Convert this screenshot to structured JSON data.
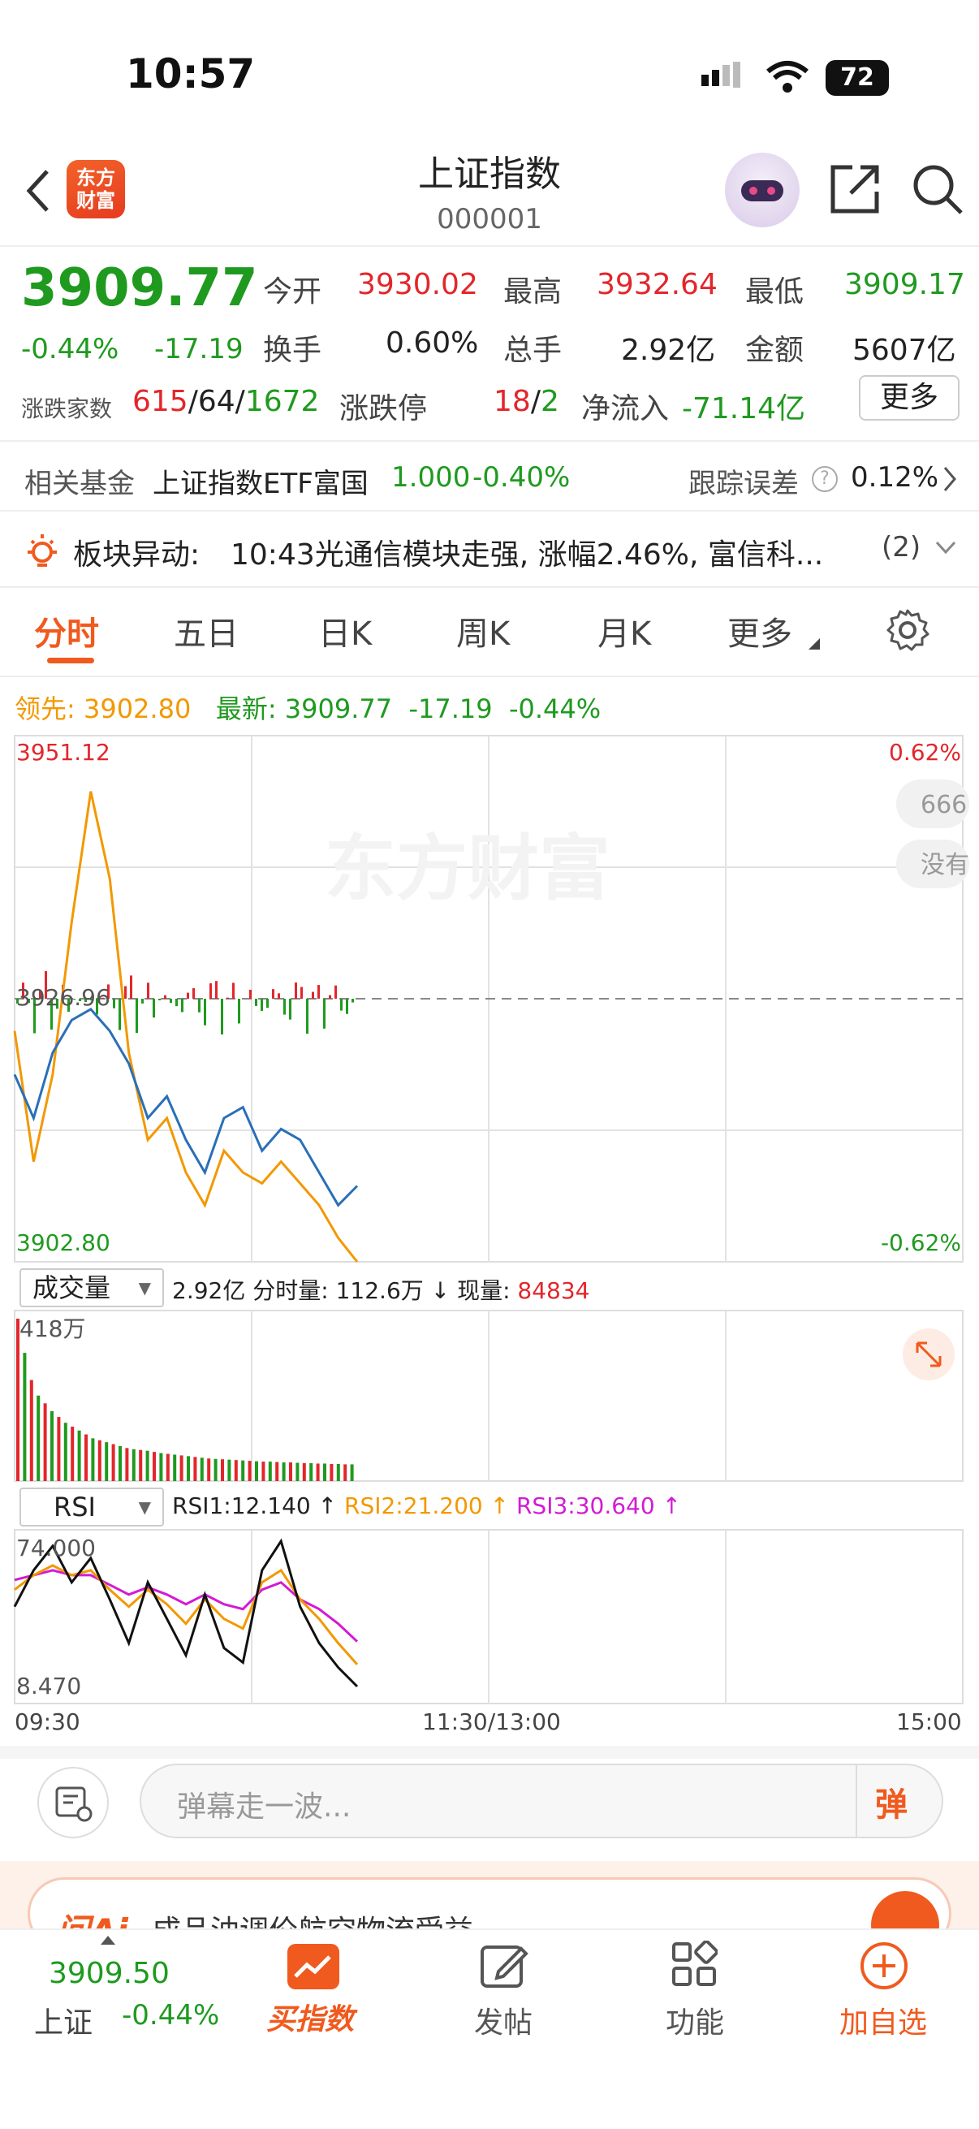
{
  "status": {
    "time": "10:57",
    "battery": "72"
  },
  "nav": {
    "title": "上证指数",
    "code": "000001",
    "logo_text_1": "东方",
    "logo_text_2": "财富"
  },
  "quote": {
    "price": "3909.77",
    "pct": "-0.44%",
    "chg": "-17.19",
    "open_label": "今开",
    "open": "3930.02",
    "high_label": "最高",
    "high": "3932.64",
    "low_label": "最低",
    "low": "3909.17",
    "turnover_label": "换手",
    "turnover": "0.60%",
    "vol_label": "总手",
    "vol": "2.92亿",
    "amount_label": "金额",
    "amount": "5607亿",
    "breadth_label": "涨跌家数",
    "breadth_up": "615",
    "breadth_flat": "64",
    "breadth_down": "1672",
    "sep": "/",
    "limit_label": "涨跌停",
    "limit_up": "18",
    "limit_down": "2",
    "netflow_label": "净流入",
    "netflow": "-71.14亿",
    "more": "更多"
  },
  "fund": {
    "label": "相关基金",
    "name": "上证指数ETF富国",
    "price": "1.000",
    "pct": "-0.40%",
    "err_label": "跟踪误差",
    "err": "0.12%"
  },
  "alert": {
    "label": "板块异动:",
    "text": "10:43光通信模块走强, 涨幅2.46%, 富信科...",
    "count": "(2)"
  },
  "tabs": [
    "分时",
    "五日",
    "日K",
    "周K",
    "月K",
    "更多"
  ],
  "legend": {
    "lead_label": "领先:",
    "lead": "3902.80",
    "latest_label": "最新:",
    "latest": "3909.77",
    "chg": "-17.19",
    "pct": "-0.44%"
  },
  "price_chart": {
    "ymax": "3951.12",
    "ymin": "3902.80",
    "pct_top": "0.62%",
    "pct_bot": "-0.62%",
    "prev_close": "3926.96",
    "pill1": "666",
    "pill2": "没有",
    "watermark": "东方财富"
  },
  "volume": {
    "selector": "成交量",
    "total": "2.92亿",
    "min_label": "分时量:",
    "min_vol": "112.6万",
    "arrow": "↓",
    "cur_label": "现量:",
    "cur": "84834",
    "ymax": "418万"
  },
  "rsi": {
    "selector": "RSI",
    "rsi1": "RSI1:12.140 ↑",
    "rsi2": "RSI2:21.200 ↑",
    "rsi3": "RSI3:30.640 ↑",
    "ymax": "74.000",
    "ymin": "8.470"
  },
  "time_axis": {
    "start": "09:30",
    "mid": "11:30/13:00",
    "end": "15:00"
  },
  "comment": {
    "placeholder": "弹幕走一波...",
    "btn": "弹"
  },
  "promo": {
    "text": "成品油调价航空物流受益",
    "brand": "问Ai"
  },
  "bottom": {
    "index_price": "3909.50",
    "index_name": "上证",
    "index_pct": "-0.44%",
    "buy": "买指数",
    "post": "发帖",
    "func": "功能",
    "add": "加自选"
  },
  "colors": {
    "up": "#e3262b",
    "down": "#1f9a1f",
    "lead_line": "#f39800",
    "price_line": "#2a6fb8",
    "accent": "#f05a1e"
  },
  "chart_data": [
    {
      "type": "line",
      "title": "分时",
      "x": [
        "09:30",
        "09:35",
        "09:40",
        "09:45",
        "09:50",
        "09:55",
        "10:00",
        "10:05",
        "10:10",
        "10:15",
        "10:20",
        "10:25",
        "10:30",
        "10:35",
        "10:40",
        "10:45",
        "10:50",
        "10:55",
        "10:57"
      ],
      "series": [
        {
          "name": "最新",
          "values": [
            3920,
            3916,
            3922,
            3925,
            3926,
            3924,
            3921,
            3916,
            3918,
            3914,
            3911,
            3916,
            3917,
            3913,
            3915,
            3914,
            3911,
            3908,
            3909.77
          ]
        },
        {
          "name": "领先",
          "values": [
            3924,
            3912,
            3920,
            3934,
            3946,
            3938,
            3922,
            3914,
            3916,
            3911,
            3908,
            3913,
            3911,
            3910,
            3912,
            3910,
            3908,
            3905,
            3902.8
          ]
        }
      ],
      "ylim": [
        3902.8,
        3951.12
      ],
      "prev_close": 3926.96
    },
    {
      "type": "bar",
      "title": "成交量",
      "ylabel": "万",
      "values": [
        418,
        330,
        260,
        220,
        200,
        180,
        165,
        150,
        140,
        130,
        120,
        110,
        105,
        100,
        95,
        90,
        85,
        82,
        80,
        78,
        75,
        72,
        70,
        68,
        66,
        64,
        62,
        60,
        58,
        57,
        56,
        55,
        54,
        53,
        52,
        51,
        50,
        50,
        49,
        48,
        48,
        47,
        46,
        46,
        45,
        45,
        44,
        44,
        43,
        43
      ]
    },
    {
      "type": "line",
      "title": "RSI",
      "ylim": [
        8.47,
        74.0
      ],
      "series": [
        {
          "name": "RSI1",
          "values": [
            45,
            60,
            70,
            55,
            65,
            48,
            30,
            55,
            40,
            25,
            50,
            28,
            22,
            60,
            72,
            45,
            30,
            20,
            12.14
          ]
        },
        {
          "name": "RSI2",
          "values": [
            52,
            58,
            62,
            58,
            60,
            52,
            45,
            52,
            46,
            38,
            48,
            40,
            36,
            55,
            60,
            48,
            40,
            30,
            21.2
          ]
        },
        {
          "name": "RSI3",
          "values": [
            56,
            58,
            60,
            58,
            58,
            54,
            50,
            53,
            50,
            46,
            50,
            46,
            44,
            52,
            55,
            48,
            44,
            38,
            30.64
          ]
        }
      ]
    }
  ]
}
